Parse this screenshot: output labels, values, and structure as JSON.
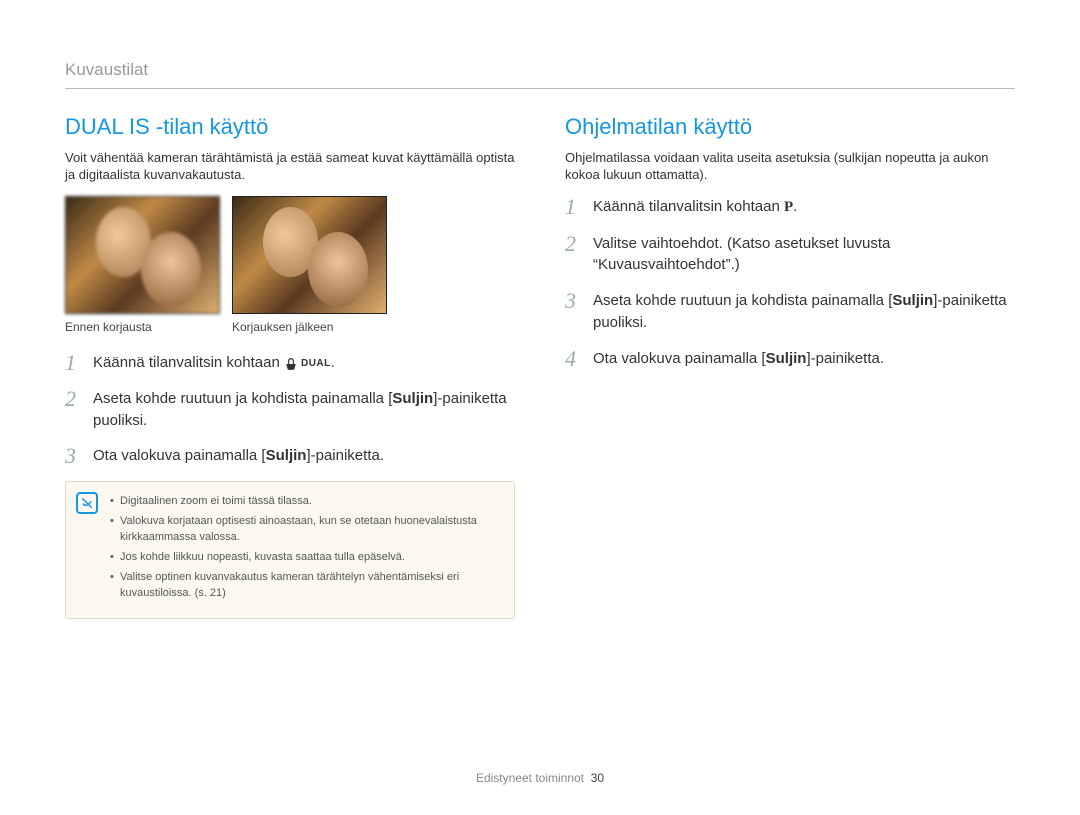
{
  "header": {
    "label": "Kuvaustilat"
  },
  "left": {
    "heading": "DUAL IS -tilan käyttö",
    "intro": "Voit vähentää kameran tärähtämistä ja estää sameat kuvat käyttämällä optista ja digitaalista kuvanvakautusta.",
    "captions": {
      "before": "Ennen korjausta",
      "after": "Korjauksen jälkeen"
    },
    "steps": [
      {
        "num": "1",
        "pre": "Käännä tilanvalitsin kohtaan ",
        "icon": "dual",
        "post": "."
      },
      {
        "num": "2",
        "pre": "Aseta kohde ruutuun ja kohdista painamalla [",
        "bold": "Suljin",
        "post": "]-painiketta puoliksi."
      },
      {
        "num": "3",
        "pre": "Ota valokuva painamalla [",
        "bold": "Suljin",
        "post": "]-painiketta."
      }
    ],
    "notes": [
      "Digitaalinen zoom ei toimi tässä tilassa.",
      "Valokuva korjataan optisesti ainoastaan, kun se otetaan huonevalaistusta kirkkaammassa valossa.",
      "Jos kohde liikkuu nopeasti, kuvasta saattaa tulla epäselvä.",
      "Valitse optinen kuvanvakautus kameran tärähtelyn vähentämiseksi eri kuvaustiloissa. (s. 21)"
    ],
    "dual_label": "DUAL"
  },
  "right": {
    "heading": "Ohjelmatilan käyttö",
    "intro": "Ohjelmatilassa voidaan valita useita asetuksia (sulkijan nopeutta ja aukon kokoa lukuun ottamatta).",
    "steps": [
      {
        "num": "1",
        "pre": "Käännä tilanvalitsin kohtaan ",
        "icon": "P",
        "post": "."
      },
      {
        "num": "2",
        "pre": "Valitse vaihtoehdot. (Katso asetukset luvusta “Kuvausvaihtoehdot”.)"
      },
      {
        "num": "3",
        "pre": "Aseta kohde ruutuun ja kohdista painamalla [",
        "bold": "Suljin",
        "post": "]-painiketta puoliksi."
      },
      {
        "num": "4",
        "pre": "Ota valokuva painamalla [",
        "bold": "Suljin",
        "post": "]-painiketta."
      }
    ]
  },
  "footer": {
    "section": "Edistyneet toiminnot",
    "page": "30"
  }
}
